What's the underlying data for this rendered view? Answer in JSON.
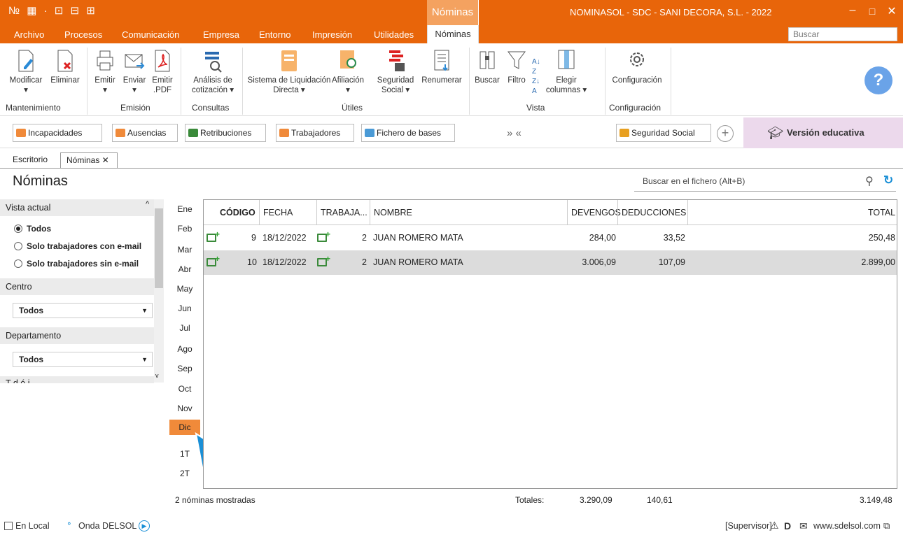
{
  "titlebar": {
    "quick_access": "№ ▦ · ⊡ ⊟ ⊞",
    "context_tab": "Nóminas",
    "app_title": "NOMINASOL - SDC - SANI DECORA, S.L. - 2022",
    "minimize": "–",
    "maximize": "□",
    "close": "✕"
  },
  "menu": {
    "items": [
      "Archivo",
      "Procesos",
      "Comunicación",
      "Empresa",
      "Entorno",
      "Impresión",
      "Utilidades"
    ],
    "active": "Nóminas",
    "search_placeholder": "Buscar"
  },
  "ribbon": {
    "buttons": [
      {
        "label": "Modificar",
        "sub": "▾"
      },
      {
        "label": "Eliminar",
        "sub": ""
      },
      {
        "label": "Emitir",
        "sub": "▾"
      },
      {
        "label": "Enviar",
        "sub": "▾"
      },
      {
        "label": "Emitir .PDF",
        "sub": ""
      },
      {
        "label": "Análisis de cotización ▾",
        "sub": ""
      },
      {
        "label": "Sistema de Liquidación Directa ▾",
        "sub": ""
      },
      {
        "label": "Afiliación",
        "sub": "▾"
      },
      {
        "label": "Seguridad Social ▾",
        "sub": ""
      },
      {
        "label": "Renumerar",
        "sub": ""
      },
      {
        "label": "Buscar",
        "sub": ""
      },
      {
        "label": "Filtro",
        "sub": ""
      },
      {
        "label": "Elegir columnas ▾",
        "sub": ""
      },
      {
        "label": "Configuración",
        "sub": ""
      }
    ],
    "groups": [
      "Mantenimiento",
      "Emisión",
      "Consultas",
      "Útiles",
      "Vista",
      "Configuración"
    ],
    "help": "?"
  },
  "shortcuts": {
    "items": [
      "Incapacidades",
      "Ausencias",
      "Retribuciones",
      "Trabajadores",
      "Fichero de bases"
    ],
    "nav": "» «",
    "seguridad": "Seguridad Social",
    "add": "+",
    "edu": "Versión educativa"
  },
  "doctabs": {
    "desk": "Escritorio",
    "nominas": "Nóminas ✕"
  },
  "page": {
    "title": "Nóminas",
    "search_placeholder": "Buscar en el fichero (Alt+B)"
  },
  "left": {
    "vista_label": "Vista actual",
    "radios": [
      "Todos",
      "Solo trabajadores con e-mail",
      "Solo trabajadores sin e-mail"
    ],
    "centro_label": "Centro",
    "centro_value": "Todos",
    "depto_label": "Departamento",
    "depto_value": "Todos",
    "cut_label": "T      d    ó   i"
  },
  "months": [
    "Ene",
    "Feb",
    "Mar",
    "Abr",
    "May",
    "Jun",
    "Jul",
    "Ago",
    "Sep",
    "Oct",
    "Nov",
    "Dic",
    "1T",
    "2T"
  ],
  "table": {
    "headers": [
      "CÓDIGO",
      "FECHA",
      "TRABAJA...",
      "NOMBRE",
      "DEVENGOS",
      "DEDUCCIONES",
      "TOTAL"
    ],
    "rows": [
      {
        "codigo": "9",
        "fecha": "18/12/2022",
        "trab": "2",
        "nombre": "JUAN ROMERO MATA",
        "devengos": "284,00",
        "deducciones": "33,52",
        "total": "250,48"
      },
      {
        "codigo": "10",
        "fecha": "18/12/2022",
        "trab": "2",
        "nombre": "JUAN ROMERO MATA",
        "devengos": "3.006,09",
        "deducciones": "107,09",
        "total": "2.899,00"
      }
    ]
  },
  "footer": {
    "count": "2 nóminas mostradas",
    "totales_label": "Totales:",
    "devengos": "3.290,09",
    "deducciones": "140,61",
    "total": "3.149,48"
  },
  "status": {
    "local": "En Local",
    "onda": "Onda DELSOL",
    "user": "[Supervisor]",
    "site": "www.sdelsol.com"
  },
  "colors": {
    "accent": "#e8650a",
    "selected_month": "#f08a3a",
    "edu_bg": "#ecd9ec",
    "cursor": "#1a8fd6"
  }
}
